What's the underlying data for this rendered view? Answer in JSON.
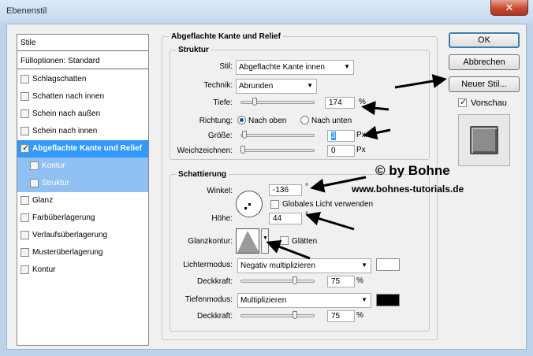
{
  "window": {
    "title": "Ebenenstil",
    "close_glyph": "✕"
  },
  "sidebar": {
    "header": "Stile",
    "blend_options": "Fülloptionen: Standard",
    "items": [
      {
        "label": "Schlagschatten",
        "checked": false,
        "state": "normal",
        "sub": false
      },
      {
        "label": "Schatten nach innen",
        "checked": false,
        "state": "normal",
        "sub": false
      },
      {
        "label": "Schein nach außen",
        "checked": false,
        "state": "normal",
        "sub": false
      },
      {
        "label": "Schein nach innen",
        "checked": false,
        "state": "normal",
        "sub": false
      },
      {
        "label": "Abgeflachte Kante und Relief",
        "checked": true,
        "state": "selected",
        "sub": false
      },
      {
        "label": "Kontur",
        "checked": false,
        "state": "highlight",
        "sub": true
      },
      {
        "label": "Struktur",
        "checked": false,
        "state": "highlight",
        "sub": true
      },
      {
        "label": "Glanz",
        "checked": false,
        "state": "normal",
        "sub": false
      },
      {
        "label": "Farbüberlagerung",
        "checked": false,
        "state": "normal",
        "sub": false
      },
      {
        "label": "Verlaufsüberlagerung",
        "checked": false,
        "state": "normal",
        "sub": false
      },
      {
        "label": "Musterüberlagerung",
        "checked": false,
        "state": "normal",
        "sub": false
      },
      {
        "label": "Kontur",
        "checked": false,
        "state": "normal",
        "sub": false
      }
    ]
  },
  "main": {
    "title": "Abgeflachte Kante und Relief",
    "structure": {
      "title": "Struktur",
      "style_label": "Stil:",
      "style_value": "Abgeflachte Kante innen",
      "technique_label": "Technik:",
      "technique_value": "Abrunden",
      "depth_label": "Tiefe:",
      "depth_value": "174",
      "depth_unit": "%",
      "depth_slider": 0.17,
      "direction_label": "Richtung:",
      "direction_up": "Nach oben",
      "direction_down": "Nach unten",
      "size_label": "Größe:",
      "size_value": "3",
      "size_unit": "Px",
      "size_slider": 0.02,
      "soften_label": "Weichzeichnen:",
      "soften_value": "0",
      "soften_unit": "Px",
      "soften_slider": 0.0
    },
    "shading": {
      "title": "Schattierung",
      "angle_label": "Winkel:",
      "angle_value": "-136",
      "angle_unit": "°",
      "global_light_label": "Globales Licht verwenden",
      "altitude_label": "Höhe:",
      "altitude_value": "44",
      "altitude_unit": "°",
      "gloss_contour_label": "Glanzkontur:",
      "anti_aliased_label": "Glätten",
      "highlight_mode_label": "Lichtermodus:",
      "highlight_mode_value": "Negativ multiplizieren",
      "highlight_color": "#ffffff",
      "highlight_opacity_label": "Deckkraft:",
      "highlight_opacity_value": "75",
      "highlight_opacity_unit": "%",
      "highlight_opacity_slider": 0.75,
      "shadow_mode_label": "Tiefenmodus:",
      "shadow_mode_value": "Multiplizieren",
      "shadow_color": "#000000",
      "shadow_opacity_label": "Deckkraft:",
      "shadow_opacity_value": "75",
      "shadow_opacity_unit": "%",
      "shadow_opacity_slider": 0.75
    }
  },
  "buttons": {
    "ok": "OK",
    "cancel": "Abbrechen",
    "new_style": "Neuer Stil...",
    "preview_label": "Vorschau"
  },
  "watermark": {
    "line1": "© by Bohne",
    "line2": "www.bohnes-tutorials.de"
  },
  "colors": {
    "selection": "#3399ff",
    "sub_highlight": "#8fc1f3",
    "frame": "#bcd3ea",
    "close": "#c84a33"
  }
}
